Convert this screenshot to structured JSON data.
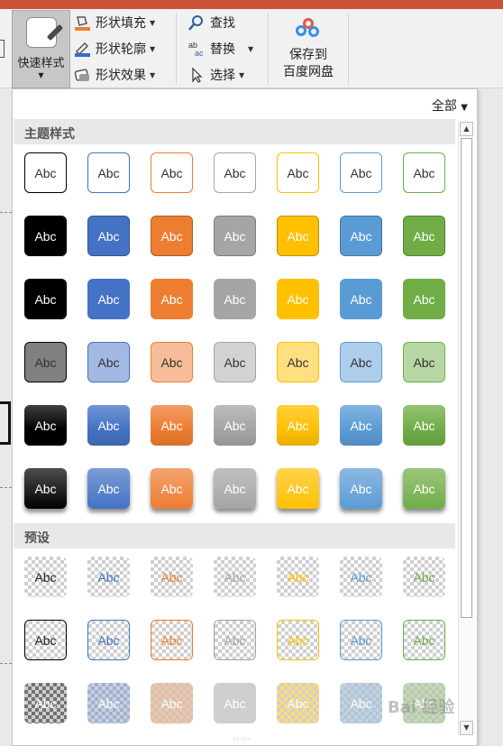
{
  "ribbon": {
    "quick_styles": {
      "label": "快速样式"
    },
    "shape_fill": {
      "label": "形状填充"
    },
    "shape_outline": {
      "label": "形状轮廓"
    },
    "shape_effects": {
      "label": "形状效果"
    },
    "find": {
      "label": "查找"
    },
    "replace": {
      "label": "替换"
    },
    "select": {
      "label": "选择"
    },
    "save_to_baidu": {
      "line1": "保存到",
      "line2": "百度网盘"
    }
  },
  "gallery": {
    "filter_label": "全部",
    "sections": {
      "theme_styles": "主题样式",
      "presets": "预设"
    },
    "cell_text": "Abc",
    "colors": [
      "#000000",
      "#4472c4",
      "#ed7d31",
      "#a5a5a5",
      "#ffc000",
      "#5b9bd5",
      "#70ad47"
    ]
  },
  "watermark": "Bai 经验"
}
